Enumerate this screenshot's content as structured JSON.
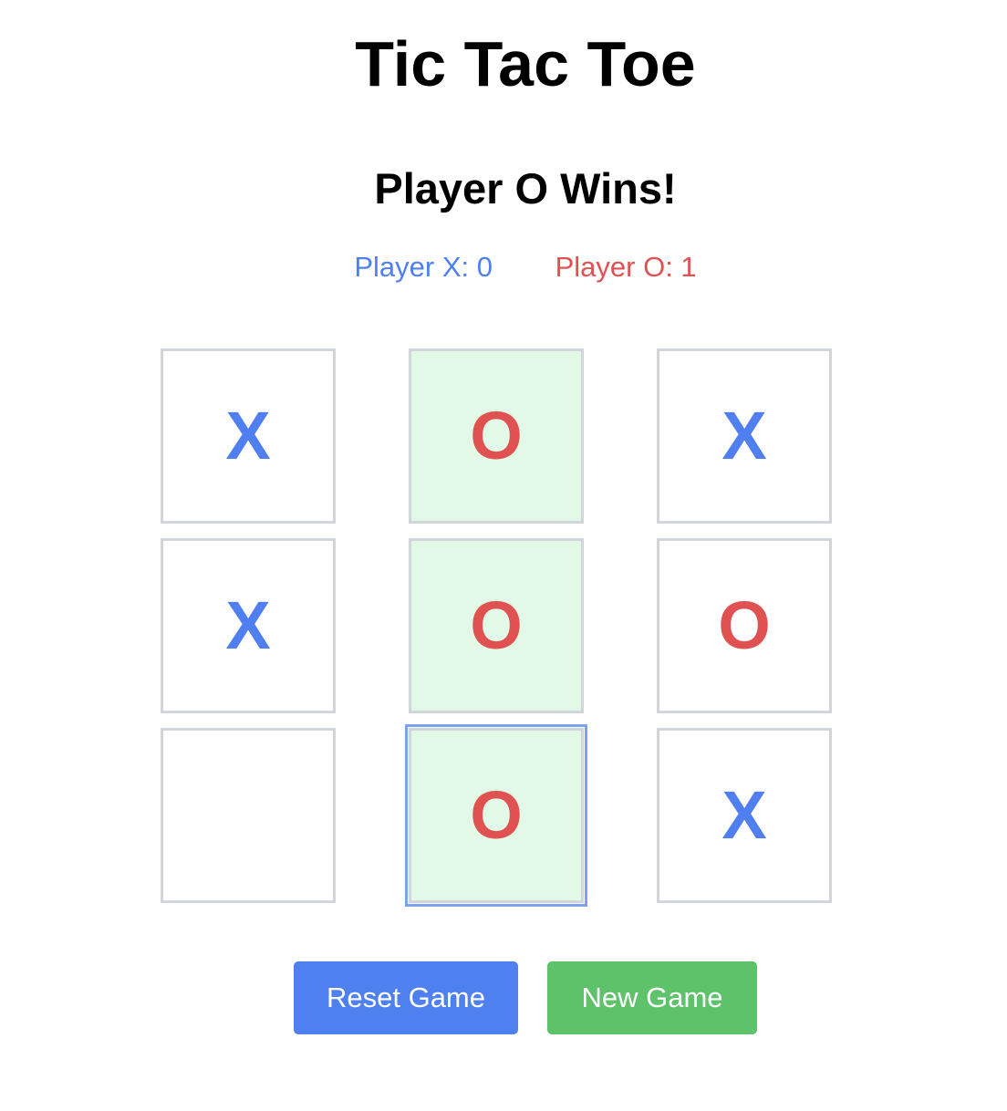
{
  "title": "Tic Tac Toe",
  "status": "Player O Wins!",
  "scores": {
    "x_label": "Player X: 0",
    "o_label": "Player O: 1"
  },
  "board": {
    "cells": [
      "X",
      "O",
      "X",
      "X",
      "O",
      "O",
      "",
      "O",
      "X"
    ],
    "winning_cells": [
      1,
      4,
      7
    ],
    "focused_cell": 7
  },
  "buttons": {
    "reset_label": "Reset Game",
    "new_label": "New Game"
  },
  "colors": {
    "x_mark": "#4f7ff0",
    "o_mark": "#e05252",
    "win_cell_bg": "#e2f9e8",
    "reset_button": "#4f80f0",
    "new_button": "#5dc26a",
    "cell_border": "#d2d5da"
  }
}
